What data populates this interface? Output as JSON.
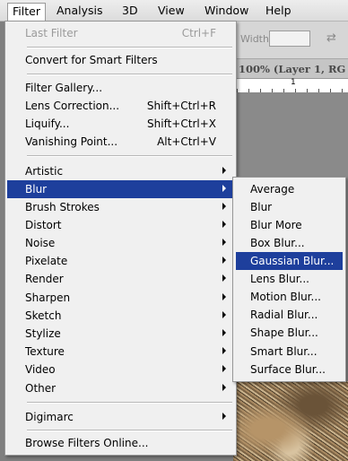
{
  "menubar": {
    "items": [
      "Filter",
      "Analysis",
      "3D",
      "View",
      "Window",
      "Help"
    ]
  },
  "options_bar": {
    "width_label": "Width:",
    "width_value": ""
  },
  "document_tab": {
    "title": "100% (Layer 1, RG"
  },
  "ruler": {
    "marker": "1"
  },
  "filter_menu": {
    "items": [
      {
        "label": "Last Filter",
        "shortcut": "Ctrl+F",
        "enabled": false
      },
      {
        "label": "Convert for Smart Filters",
        "shortcut": ""
      },
      {
        "label": "Filter Gallery...",
        "shortcut": ""
      },
      {
        "label": "Lens Correction...",
        "shortcut": "Shift+Ctrl+R"
      },
      {
        "label": "Liquify...",
        "shortcut": "Shift+Ctrl+X"
      },
      {
        "label": "Vanishing Point...",
        "shortcut": "Alt+Ctrl+V"
      },
      {
        "label": "Artistic",
        "submenu": true
      },
      {
        "label": "Blur",
        "submenu": true,
        "selected": true
      },
      {
        "label": "Brush Strokes",
        "submenu": true
      },
      {
        "label": "Distort",
        "submenu": true
      },
      {
        "label": "Noise",
        "submenu": true
      },
      {
        "label": "Pixelate",
        "submenu": true
      },
      {
        "label": "Render",
        "submenu": true
      },
      {
        "label": "Sharpen",
        "submenu": true
      },
      {
        "label": "Sketch",
        "submenu": true
      },
      {
        "label": "Stylize",
        "submenu": true
      },
      {
        "label": "Texture",
        "submenu": true
      },
      {
        "label": "Video",
        "submenu": true
      },
      {
        "label": "Other",
        "submenu": true
      },
      {
        "label": "Digimarc",
        "submenu": true
      },
      {
        "label": "Browse Filters Online...",
        "shortcut": ""
      }
    ]
  },
  "blur_submenu": {
    "items": [
      {
        "label": "Average"
      },
      {
        "label": "Blur"
      },
      {
        "label": "Blur More"
      },
      {
        "label": "Box Blur..."
      },
      {
        "label": "Gaussian Blur...",
        "selected": true
      },
      {
        "label": "Lens Blur..."
      },
      {
        "label": "Motion Blur..."
      },
      {
        "label": "Radial Blur..."
      },
      {
        "label": "Shape Blur..."
      },
      {
        "label": "Smart Blur..."
      },
      {
        "label": "Surface Blur..."
      }
    ]
  },
  "colors": {
    "highlight": "#1e3f9c",
    "menu_bg": "#f0f0f0",
    "disabled_text": "#9a9a9a"
  },
  "icons": {
    "submenu_arrow": "chevron-right-icon",
    "link_toggle": "swap-icon"
  }
}
